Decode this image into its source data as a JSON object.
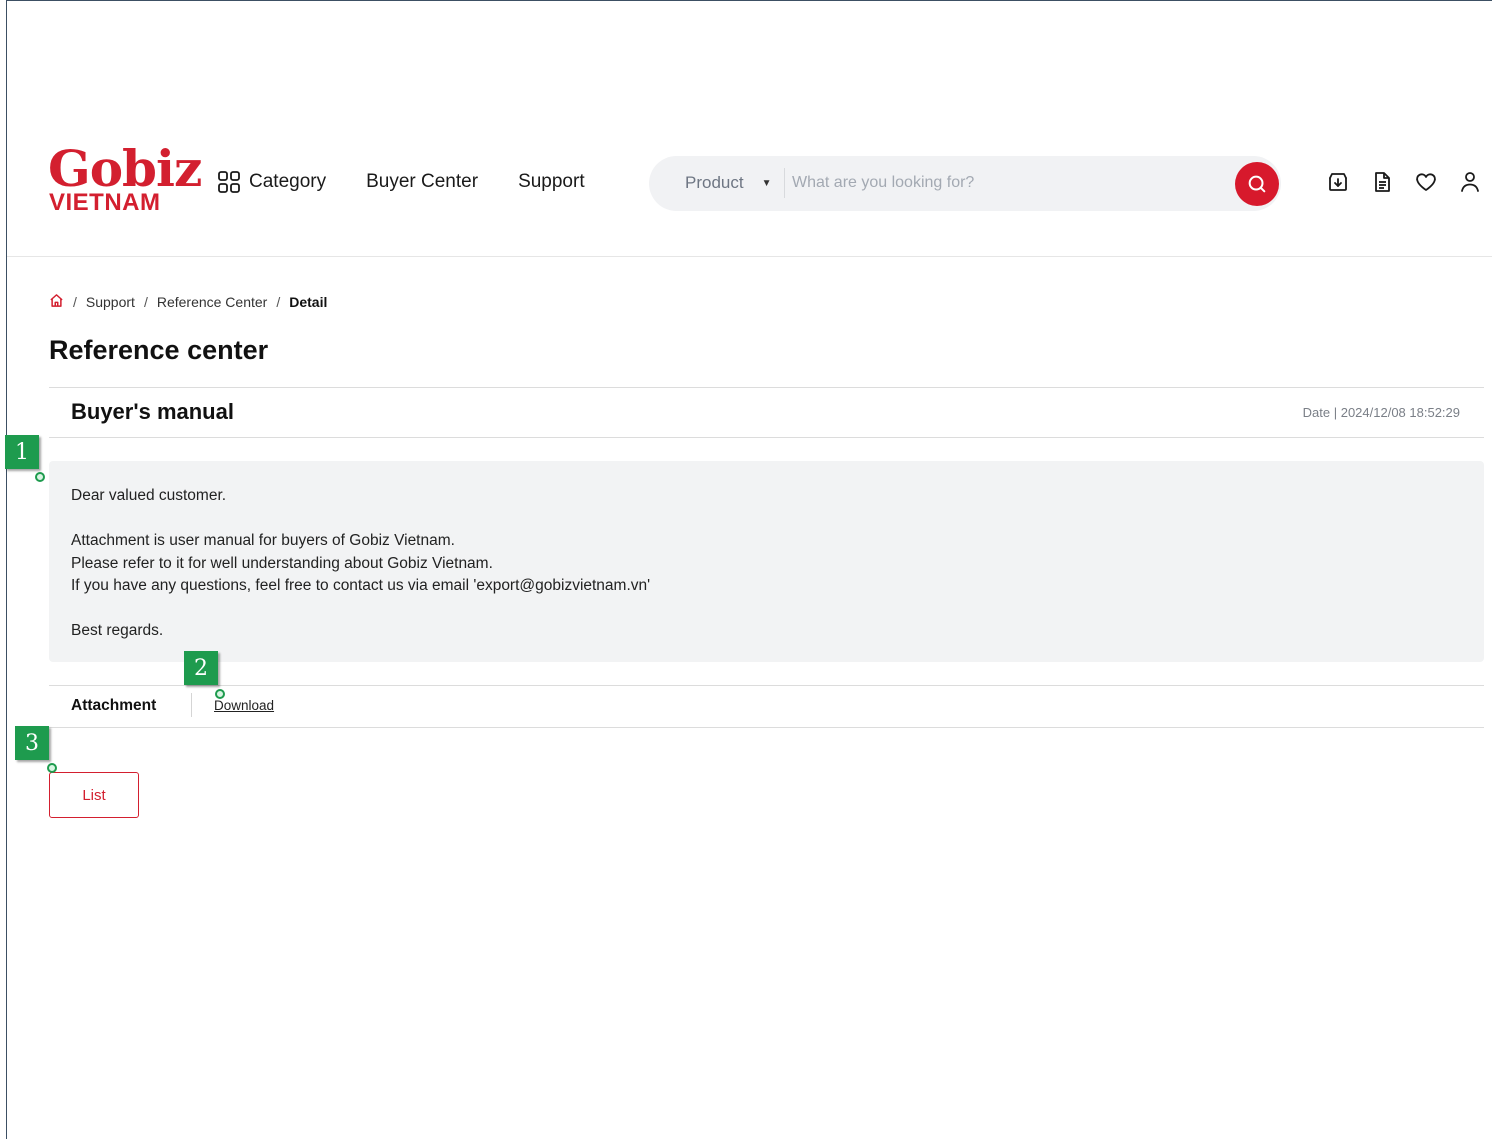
{
  "logo": {
    "line1": "Gobiz",
    "line2": "VIETNAM"
  },
  "nav": {
    "category": "Category",
    "buyer_center": "Buyer Center",
    "support": "Support"
  },
  "search": {
    "scope": "Product",
    "placeholder": "What are you looking for?"
  },
  "header_icons": [
    "download-box-icon",
    "document-icon",
    "heart-icon",
    "user-icon"
  ],
  "breadcrumb": {
    "items": [
      "Support",
      "Reference Center"
    ],
    "current": "Detail"
  },
  "page_title": "Reference center",
  "article": {
    "title": "Buyer's manual",
    "date": "Date | 2024/12/08 18:52:29",
    "body": {
      "greeting": "Dear valued customer.",
      "line1": "Attachment is user manual for buyers of Gobiz Vietnam.",
      "line2": "Please refer to it for well understanding about Gobiz Vietnam.",
      "line3": "If you have any questions, feel free to contact us via email 'export@gobizvietnam.vn'",
      "closing": "Best regards."
    }
  },
  "attachment": {
    "label": "Attachment",
    "link": "Download"
  },
  "list_button": "List",
  "markers": [
    "1",
    "2",
    "3"
  ],
  "colors": {
    "brand": "#d31f2f",
    "marker": "#1e9b4e",
    "content_bg": "#f2f3f4"
  }
}
